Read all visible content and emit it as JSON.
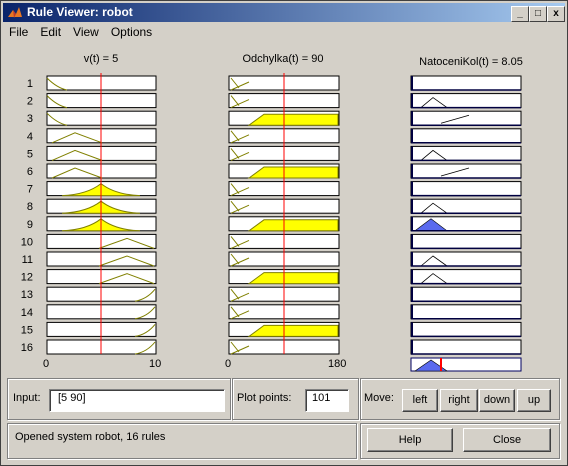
{
  "window": {
    "title": "Rule Viewer: robot",
    "controls": {
      "minimize": "_",
      "maximize": "□",
      "close": "x"
    }
  },
  "menu": [
    "File",
    "Edit",
    "View",
    "Options"
  ],
  "inputs": [
    {
      "label": "v(t) = 5",
      "xmin": "0",
      "xmax": "10"
    },
    {
      "label": "Odchylka(t) = 90",
      "xmin": "0",
      "xmax": "180"
    }
  ],
  "output": {
    "label": "NatoceniKol(t) = 8.05"
  },
  "rules": [
    "1",
    "2",
    "3",
    "4",
    "5",
    "6",
    "7",
    "8",
    "9",
    "10",
    "11",
    "12",
    "13",
    "14",
    "15",
    "16"
  ],
  "form": {
    "input_label": "Input:",
    "input_value": "[5 90]",
    "plot_points_label": "Plot points:",
    "plot_points_value": "101",
    "move_label": "Move:",
    "move_buttons": [
      "left",
      "right",
      "down",
      "up"
    ],
    "status": "Opened system robot, 16 rules",
    "help": "Help",
    "close": "Close"
  },
  "colors": {
    "active_fill": "#ffff00",
    "output_fill": "#5a6aee",
    "cursor": "#ff0000",
    "mf_line": "#808000"
  }
}
